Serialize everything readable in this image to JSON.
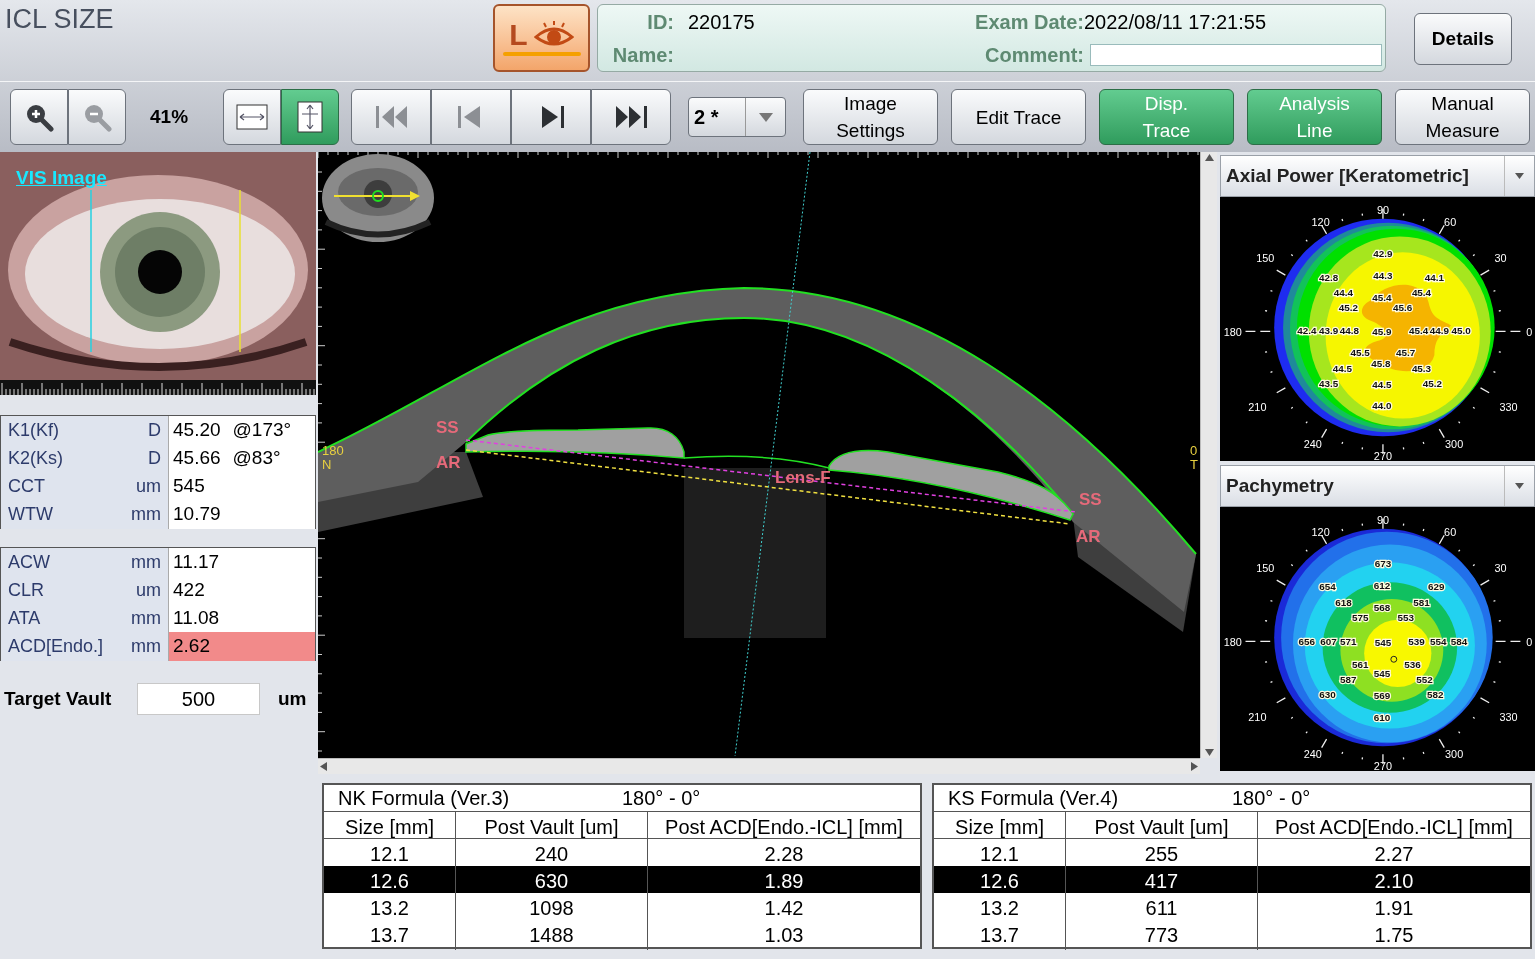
{
  "title": "ICL SIZE",
  "eye_button": {
    "label": "L"
  },
  "patient": {
    "id_label": "ID:",
    "id": "220175",
    "name_label": "Name:",
    "exam_date_label": "Exam Date:",
    "exam_date": "2022/08/11 17:21:55",
    "comment_label": "Comment:"
  },
  "details_button": "Details",
  "toolbar": {
    "zoom_buttons": [
      {
        "kind": "zoom-in",
        "disabled": false
      },
      {
        "kind": "zoom-out",
        "disabled": true
      }
    ],
    "zoom": "41%",
    "fit_buttons": [
      {
        "kind": "fit-width",
        "selected": false
      },
      {
        "kind": "fit-height",
        "selected": true
      }
    ],
    "nav_buttons": [
      {
        "kind": "first",
        "disabled": true
      },
      {
        "kind": "prev",
        "disabled": true
      },
      {
        "kind": "next",
        "disabled": false
      },
      {
        "kind": "last",
        "disabled": false
      }
    ],
    "image_select": "2 *",
    "buttons": [
      {
        "label": "Image\nSettings",
        "selected": false
      },
      {
        "label": "Edit Trace",
        "selected": false
      },
      {
        "label": "Disp.\nTrace",
        "selected": true
      },
      {
        "label": "Analysis\nLine",
        "selected": true
      },
      {
        "label": "Manual\nMeasure",
        "selected": false
      }
    ]
  },
  "vis_image": {
    "link": "VIS Image"
  },
  "measurements": [
    [
      {
        "label": "K1(Kf)",
        "unit": "D",
        "value": "45.20",
        "axis": "@173°",
        "highlighted": false
      },
      {
        "label": "K2(Ks)",
        "unit": "D",
        "value": "45.66",
        "axis": "@83°",
        "highlighted": false
      },
      {
        "label": "CCT",
        "unit": "um",
        "value": "545",
        "highlighted": false
      },
      {
        "label": "WTW",
        "unit": "mm",
        "value": "10.79",
        "highlighted": false
      }
    ],
    [
      {
        "label": "ACW",
        "unit": "mm",
        "value": "11.17",
        "highlighted": false
      },
      {
        "label": "CLR",
        "unit": "um",
        "value": "422",
        "highlighted": false
      },
      {
        "label": "ATA",
        "unit": "mm",
        "value": "11.08",
        "highlighted": false
      },
      {
        "label": "ACD[Endo.]",
        "unit": "mm",
        "value": "2.62",
        "highlighted": true
      }
    ]
  ],
  "target_vault": {
    "label": "Target Vault",
    "value": "500",
    "unit": "um"
  },
  "oct": {
    "labels": [
      "180",
      "N",
      "0",
      "T",
      "SS",
      "AR",
      "Lens-F",
      "SS",
      "AR"
    ]
  },
  "maps": [
    {
      "title": "Axial Power [Keratometric]",
      "kind": "axial",
      "angle_labels": [
        "90",
        "120",
        "60",
        "150",
        "30",
        "180",
        "0",
        "210",
        "330",
        "240",
        "300",
        "270"
      ],
      "values": [
        "42.9",
        "42.8",
        "44.3",
        "44.1",
        "44.4",
        "45.4",
        "45.4",
        "45.2",
        "45.6",
        "42.4",
        "43.9",
        "44.8",
        "45.9",
        "45.4",
        "44.9",
        "45.0",
        "45.5",
        "45.8",
        "45.7",
        "44.5",
        "45.3",
        "43.5",
        "44.5",
        "45.2",
        "44.0"
      ]
    },
    {
      "title": "Pachymetry",
      "kind": "pachymetry",
      "angle_labels": [
        "90",
        "120",
        "60",
        "150",
        "30",
        "180",
        "0",
        "210",
        "330",
        "240",
        "300",
        "270"
      ],
      "values": [
        "673",
        "654",
        "612",
        "629",
        "618",
        "568",
        "581",
        "575",
        "553",
        "656",
        "607",
        "571",
        "545",
        "539",
        "554",
        "584",
        "561",
        "536",
        "545",
        "587",
        "552",
        "630",
        "569",
        "582",
        "610"
      ]
    }
  ],
  "formulas": [
    {
      "title": "NK Formula (Ver.3)",
      "range": "180° - 0°",
      "columns": [
        "Size [mm]",
        "Post Vault [um]",
        "Post ACD[Endo.-ICL] [mm]"
      ],
      "rows": [
        {
          "cells": [
            "12.1",
            "240",
            "2.28"
          ],
          "selected": false
        },
        {
          "cells": [
            "12.6",
            "630",
            "1.89"
          ],
          "selected": true
        },
        {
          "cells": [
            "13.2",
            "1098",
            "1.42"
          ],
          "selected": false
        },
        {
          "cells": [
            "13.7",
            "1488",
            "1.03"
          ],
          "selected": false
        }
      ]
    },
    {
      "title": "KS Formula (Ver.4)",
      "range": "180° - 0°",
      "columns": [
        "Size [mm]",
        "Post Vault [um]",
        "Post ACD[Endo.-ICL] [mm]"
      ],
      "rows": [
        {
          "cells": [
            "12.1",
            "255",
            "2.27"
          ],
          "selected": false
        },
        {
          "cells": [
            "12.6",
            "417",
            "2.10"
          ],
          "selected": true
        },
        {
          "cells": [
            "13.2",
            "611",
            "1.91"
          ],
          "selected": false
        },
        {
          "cells": [
            "13.7",
            "773",
            "1.75"
          ],
          "selected": false
        }
      ]
    }
  ]
}
